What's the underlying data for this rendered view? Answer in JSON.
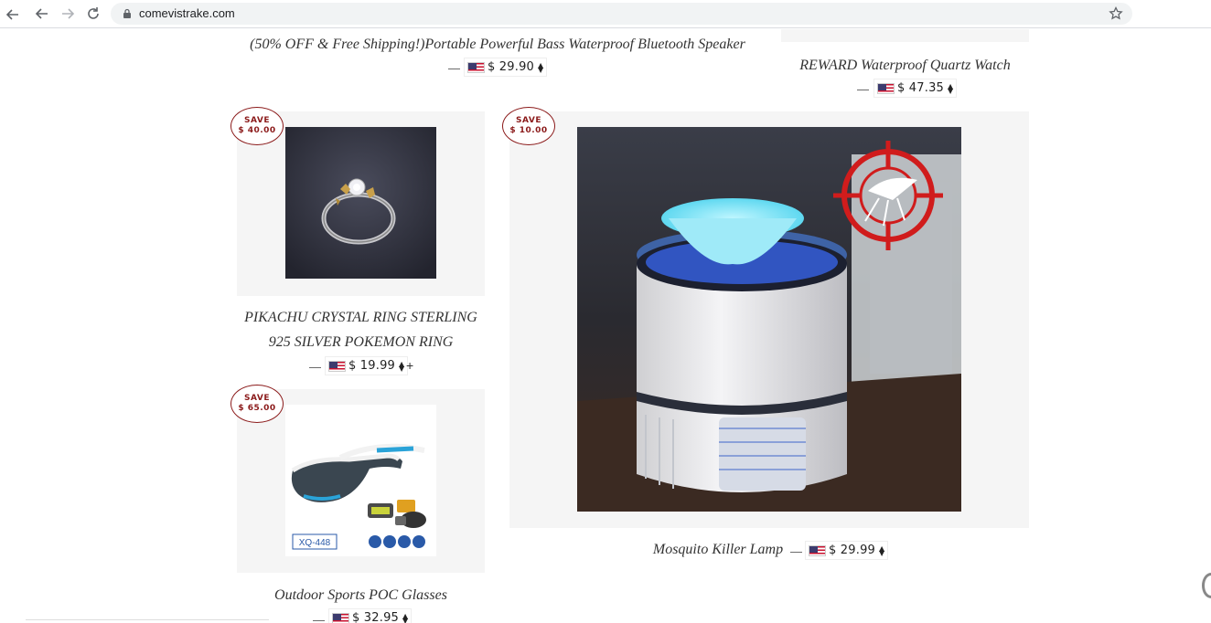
{
  "browser": {
    "url": "comevistrake.com"
  },
  "products": {
    "speaker": {
      "title": "(50% OFF & Free Shipping!)Portable Powerful Bass Waterproof Bluetooth Speaker",
      "dash": "—",
      "price": "$ 29.90"
    },
    "watch": {
      "title": "REWARD Waterproof Quartz Watch",
      "dash": "—",
      "price": "$ 47.35"
    },
    "ring": {
      "save_label": "SAVE",
      "save_amount": "$ 40.00",
      "title_line1": "PIKACHU CRYSTAL RING STERLING",
      "title_line2": "925 SILVER POKEMON RING",
      "dash": "—",
      "price": "$ 19.99",
      "plus": "+"
    },
    "lamp": {
      "save_label": "SAVE",
      "save_amount": "$ 10.00",
      "title": "Mosquito Killer Lamp",
      "dash": "—",
      "price": "$ 29.99"
    },
    "glasses": {
      "save_label": "SAVE",
      "save_amount": "$ 65.00",
      "title": "Outdoor Sports POC Glasses",
      "dash": "—",
      "price": "$ 32.95",
      "model_label": "XQ-448"
    }
  },
  "colors": {
    "save_badge": "#8b1a1a",
    "card_bg": "#f5f5f5"
  }
}
